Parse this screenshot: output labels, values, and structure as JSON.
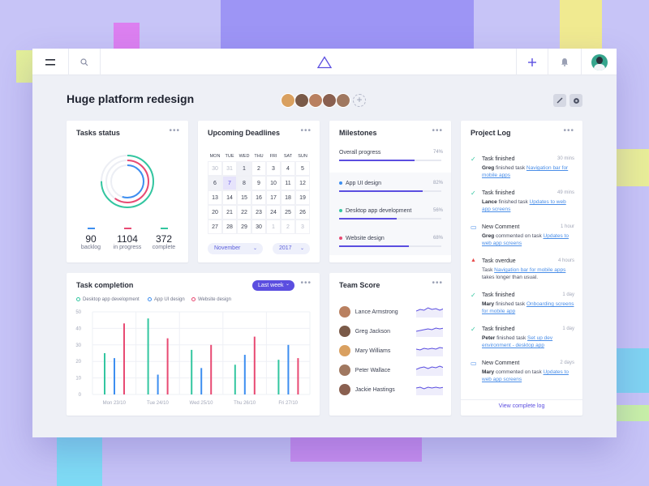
{
  "background_shapes": {
    "colors": [
      "#d97ff2",
      "#9a8ff5",
      "#f2ea8f",
      "#7fdcf5",
      "#c18ff2",
      "#7fb9f2",
      "#dff28f"
    ]
  },
  "topbar": {
    "menu_icon": "hamburger-icon",
    "search_icon": "search-icon",
    "logo_icon": "triangle-logo-icon",
    "add_icon": "plus-icon",
    "bell_icon": "bell-icon",
    "avatar_icon": "user-avatar"
  },
  "header": {
    "title": "Huge platform redesign",
    "edit_icon": "pencil-icon",
    "settings_icon": "gear-icon"
  },
  "tasks_status": {
    "title": "Tasks status",
    "more": "•••",
    "rings": [
      {
        "color": "#33c6a0",
        "value": 0.75
      },
      {
        "color": "#e84a73",
        "value": 0.6
      },
      {
        "color": "#3d8ef0",
        "value": 0.55
      }
    ],
    "stats": [
      {
        "value": "90",
        "label": "backlog",
        "color": "#3d8ef0"
      },
      {
        "value": "1104",
        "label": "in progress",
        "color": "#e84a73"
      },
      {
        "value": "372",
        "label": "complete",
        "color": "#33c6a0"
      }
    ]
  },
  "deadlines": {
    "title": "Upcoming Deadlines",
    "more": "•••",
    "weekdays": [
      "MON",
      "TUE",
      "WED",
      "THU",
      "FRI",
      "SAT",
      "SUN"
    ],
    "weeks": [
      [
        "30",
        "31",
        "1",
        "2",
        "3",
        "4",
        "5"
      ],
      [
        "6",
        "7",
        "8",
        "9",
        "10",
        "11",
        "12"
      ],
      [
        "13",
        "14",
        "15",
        "16",
        "17",
        "18",
        "19"
      ],
      [
        "20",
        "21",
        "22",
        "23",
        "24",
        "25",
        "26"
      ],
      [
        "27",
        "28",
        "29",
        "30",
        "1",
        "2",
        "3"
      ]
    ],
    "month": "November",
    "year": "2017"
  },
  "milestones": {
    "title": "Milestones",
    "more": "•••",
    "items": [
      {
        "label": "Overall progress",
        "pct": "74%",
        "value": 0.74,
        "color": "#e84a73",
        "dot": ""
      },
      {
        "label": "App UI design",
        "pct": "82%",
        "value": 0.82,
        "color": "#5b4ee0",
        "dot": "#3d8ef0"
      },
      {
        "label": "Desktop app development",
        "pct": "56%",
        "value": 0.56,
        "color": "#5b4ee0",
        "dot": "#33c6a0"
      },
      {
        "label": "Website design",
        "pct": "68%",
        "value": 0.68,
        "color": "#5b4ee0",
        "dot": "#e84a73"
      }
    ]
  },
  "project_log": {
    "title": "Project Log",
    "more": "•••",
    "items": [
      {
        "icon": "check-icon",
        "head": "Task finished",
        "time": "30 mins",
        "user": "Greg",
        "text": " finished task ",
        "link": "Navigation bar for mobile apps",
        "tail": ""
      },
      {
        "icon": "check-icon",
        "head": "Task finished",
        "time": "49 mins",
        "user": "Lance",
        "text": " finished task ",
        "link": "Updates to web app screens",
        "tail": ""
      },
      {
        "icon": "comment-icon",
        "head": "New Comment",
        "time": "1 hour",
        "user": "Greg",
        "text": " commented on task ",
        "link": "Updates to web app screens",
        "tail": ""
      },
      {
        "icon": "warning-icon",
        "head": "Task overdue",
        "time": "4 hours",
        "user": "",
        "text": "Task ",
        "link": "Navigation bar for mobile apps",
        "tail": " takes longer than usual."
      },
      {
        "icon": "check-icon",
        "head": "Task finished",
        "time": "1 day",
        "user": "Mary",
        "text": " finished task ",
        "link": "Onboarding screens for mobile app",
        "tail": ""
      },
      {
        "icon": "check-icon",
        "head": "Task finished",
        "time": "1 day",
        "user": "Peter",
        "text": " finished task ",
        "link": "Set up dev environment - desktop app",
        "tail": ""
      },
      {
        "icon": "comment-icon",
        "head": "New Comment",
        "time": "2 days",
        "user": "Mary",
        "text": " commented on task ",
        "link": "Updates to web app screens",
        "tail": ""
      }
    ],
    "footer": "View complete log"
  },
  "task_completion": {
    "title": "Task completion",
    "filter": "Last week",
    "more": "•••"
  },
  "team_score": {
    "title": "Team Score",
    "more": "•••",
    "members": [
      {
        "name": "Lance Armstrong",
        "avatar_color": "#b98060"
      },
      {
        "name": "Greg Jackson",
        "avatar_color": "#7a5a48"
      },
      {
        "name": "Mary Williams",
        "avatar_color": "#d9a060"
      },
      {
        "name": "Peter Wallace",
        "avatar_color": "#a07860"
      },
      {
        "name": "Jackie Hastings",
        "avatar_color": "#8a6050"
      }
    ]
  },
  "chart_data": {
    "type": "bar",
    "categories": [
      "Mon 23/10",
      "Tue 24/10",
      "Wed 25/10",
      "Thu 26/10",
      "Fri 27/10"
    ],
    "series": [
      {
        "name": "Desktop app development",
        "color": "#33c6a0",
        "values": [
          25,
          46,
          27,
          18,
          21
        ]
      },
      {
        "name": "App UI design",
        "color": "#3d8ef0",
        "values": [
          22,
          12,
          16,
          24,
          30
        ]
      },
      {
        "name": "Website design",
        "color": "#e84a73",
        "values": [
          43,
          34,
          30,
          35,
          22
        ]
      }
    ],
    "ylim": [
      0,
      50
    ],
    "yticks": [
      "50",
      "40",
      "30",
      "20",
      "10",
      "0"
    ],
    "grid": true,
    "legend": "top-left"
  }
}
